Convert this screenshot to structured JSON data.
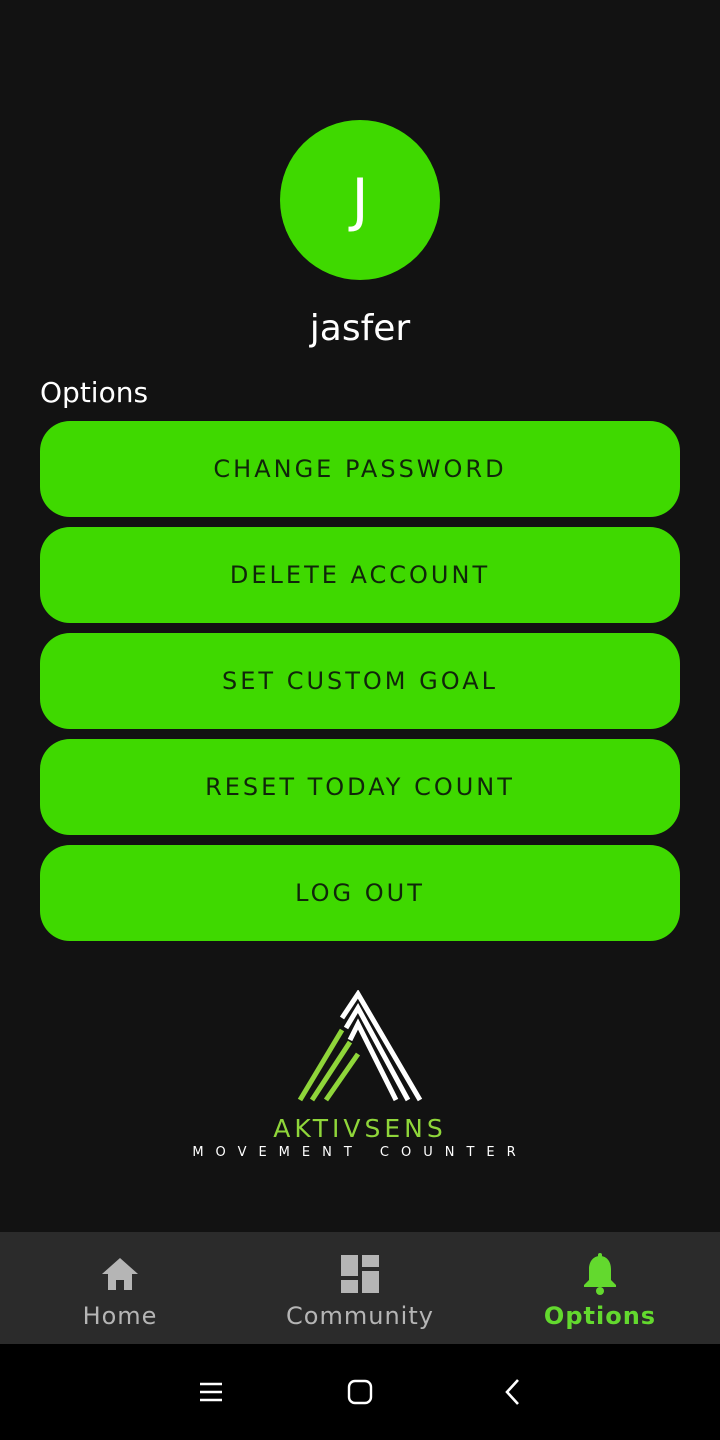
{
  "profile": {
    "avatar_initial": "J",
    "username": "jasfer"
  },
  "options": {
    "section_label": "Options",
    "buttons": [
      {
        "label": "CHANGE PASSWORD"
      },
      {
        "label": "DELETE ACCOUNT"
      },
      {
        "label": "SET CUSTOM GOAL"
      },
      {
        "label": "RESET TODAY COUNT"
      },
      {
        "label": "LOG OUT"
      }
    ]
  },
  "logo": {
    "name": "AKTIVSENS",
    "tagline": "MOVEMENT COUNTER"
  },
  "bottom_nav": {
    "items": [
      {
        "label": "Home",
        "icon": "home-icon",
        "active": false
      },
      {
        "label": "Community",
        "icon": "dashboard-icon",
        "active": false
      },
      {
        "label": "Options",
        "icon": "bell-icon",
        "active": true
      }
    ]
  },
  "colors": {
    "background": "#121212",
    "accent": "#3fd900",
    "nav_active": "#63d92e",
    "nav_inactive": "#b5b5b5",
    "nav_background": "#2b2b2b"
  },
  "system_nav": {
    "icons": [
      "recents-icon",
      "home-circle-icon",
      "back-icon"
    ]
  }
}
